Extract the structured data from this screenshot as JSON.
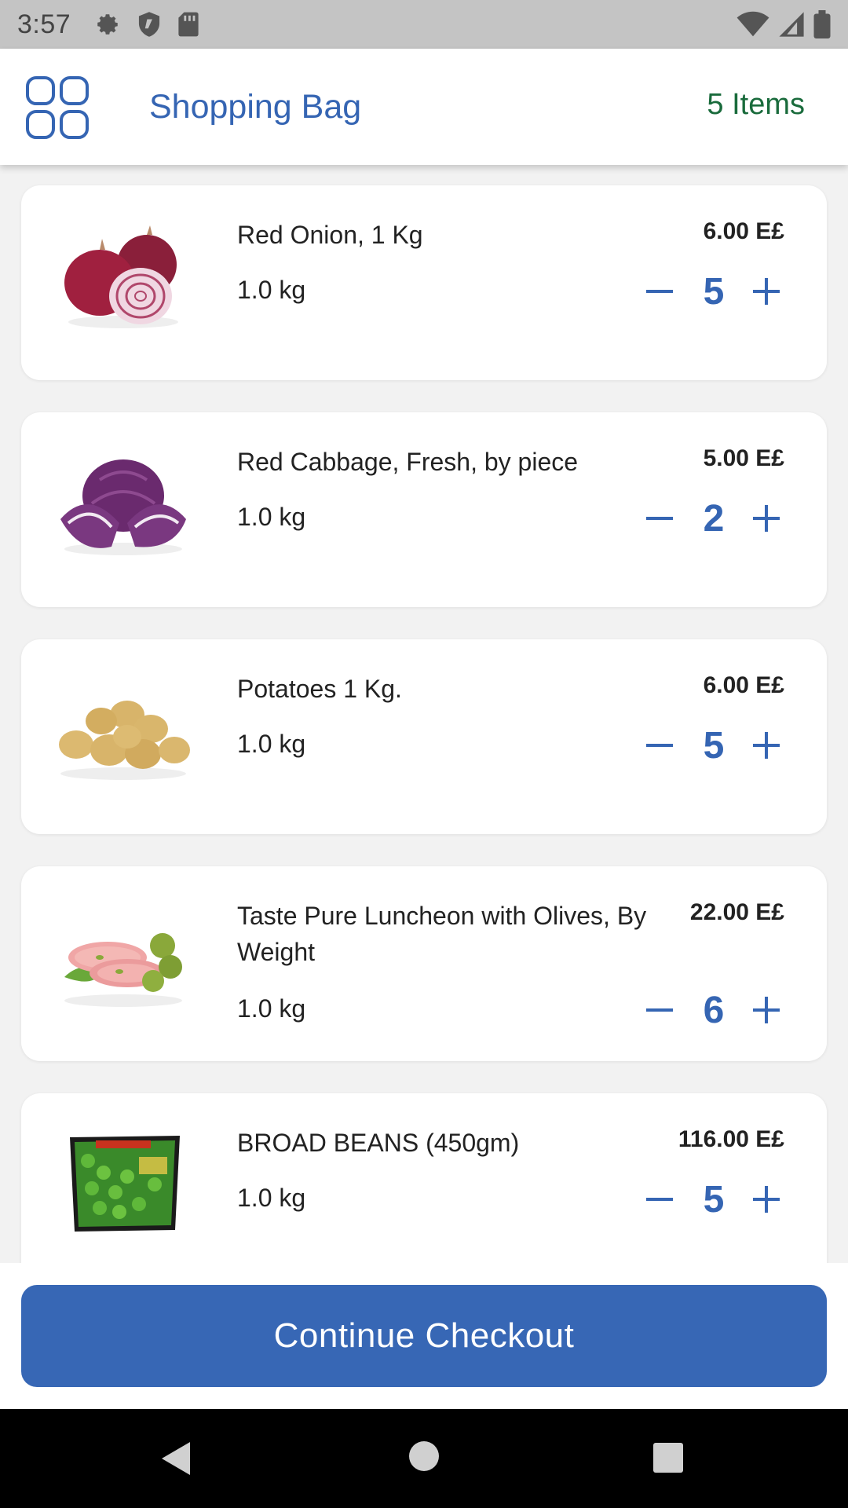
{
  "status_bar": {
    "time": "3:57",
    "icons_left": [
      "gear-icon",
      "shield-icon",
      "sd-card-icon"
    ],
    "icons_right": [
      "wifi-icon",
      "signal-icon",
      "battery-icon"
    ]
  },
  "header": {
    "title": "Shopping Bag",
    "item_count": "5 Items",
    "menu_icon": "grid-icon"
  },
  "items": [
    {
      "name": "Red Onion, 1 Kg",
      "price": "6.00 E£",
      "weight": "1.0 kg",
      "quantity": "5",
      "image": "red-onion"
    },
    {
      "name": "Red Cabbage, Fresh, by piece",
      "price": "5.00 E£",
      "weight": "1.0 kg",
      "quantity": "2",
      "image": "red-cabbage"
    },
    {
      "name": "Potatoes 1 Kg.",
      "price": "6.00 E£",
      "weight": "1.0 kg",
      "quantity": "5",
      "image": "potatoes"
    },
    {
      "name": "Taste Pure Luncheon with Olives, By Weight",
      "price": "22.00 E£",
      "weight": "1.0 kg",
      "quantity": "6",
      "image": "luncheon"
    },
    {
      "name": "BROAD BEANS (450gm)",
      "price": "116.00 E£",
      "weight": "1.0 kg",
      "quantity": "5",
      "image": "broad-beans"
    }
  ],
  "checkout": {
    "label": "Continue Checkout"
  },
  "colors": {
    "accent": "#3565b3",
    "count_green": "#1a6b3c",
    "button": "#3767b5"
  }
}
